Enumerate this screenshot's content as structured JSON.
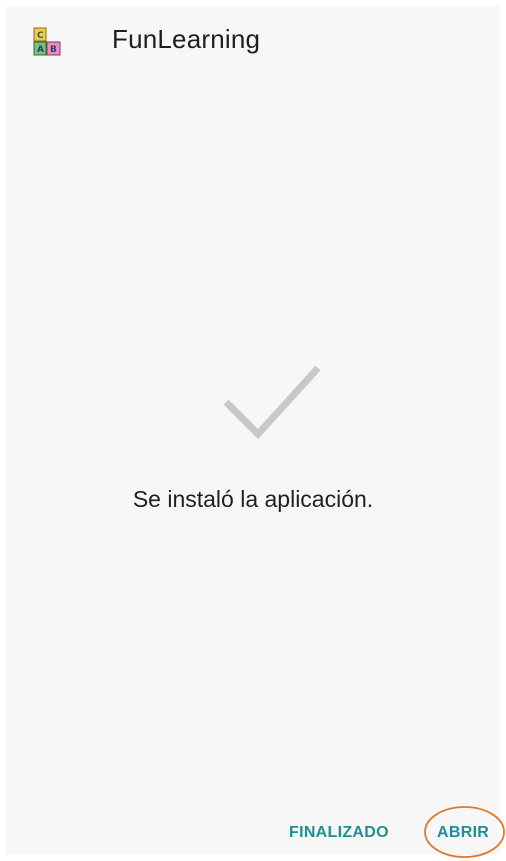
{
  "app_bar": {
    "title": "FunLearning",
    "icon": "abc-blocks-icon"
  },
  "main": {
    "status_icon": "checkmark-icon",
    "message": "Se instaló la aplicación."
  },
  "actions": {
    "done_label": "FINALIZADO",
    "open_label": "ABRIR"
  },
  "colors": {
    "accent": "#1f8f96",
    "highlight_ring": "#e07a2a",
    "background": "#f7f7f7",
    "check": "#c8c8c8"
  }
}
